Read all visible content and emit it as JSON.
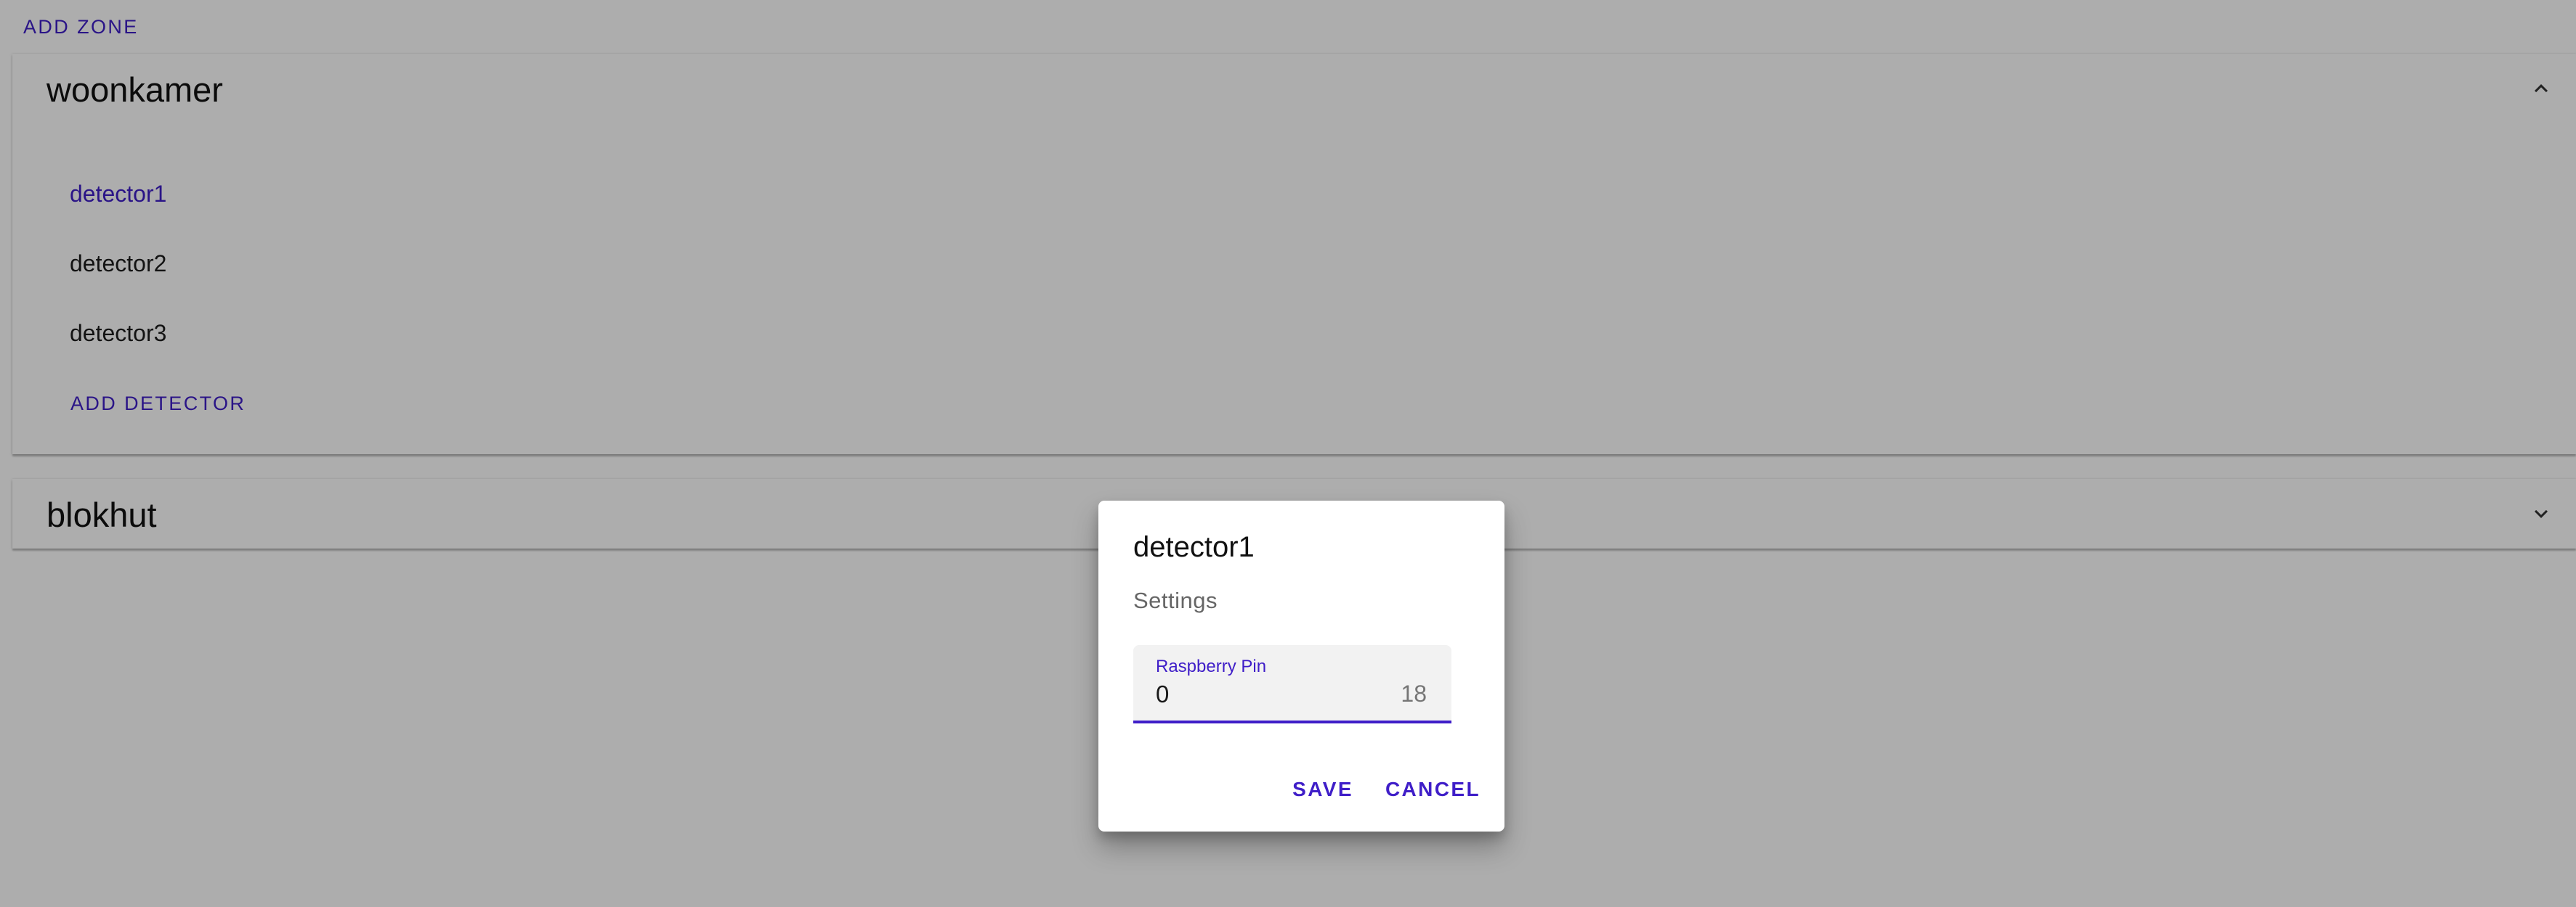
{
  "add_zone_label": "ADD ZONE",
  "zones": [
    {
      "name": "woonkamer",
      "expanded": true,
      "detectors": [
        "detector1",
        "detector2",
        "detector3"
      ],
      "add_detector_label": "ADD DETECTOR"
    },
    {
      "name": "blokhut",
      "expanded": false
    }
  ],
  "dialog": {
    "title": "detector1",
    "subtitle": "Settings",
    "field": {
      "label": "Raspberry Pin",
      "value": "0",
      "suffix": "18"
    },
    "save_label": "SAVE",
    "cancel_label": "CANCEL"
  },
  "icons": {
    "expanded": "chevron-up-icon",
    "collapsed": "chevron-down-icon"
  },
  "colors": {
    "accent": "#3f1ec8",
    "scrim": "rgba(0,0,0,0.32)"
  }
}
